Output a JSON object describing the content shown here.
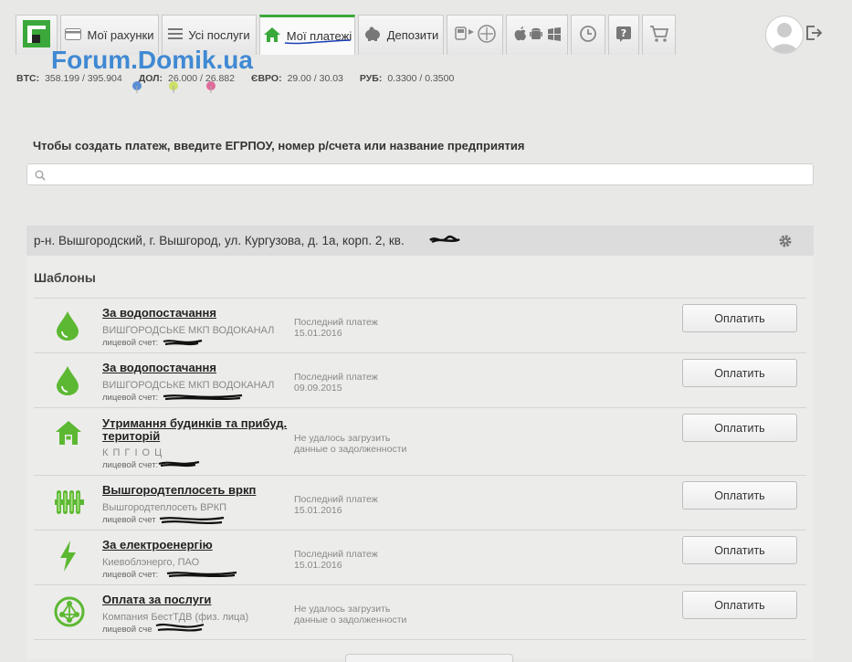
{
  "nav": {
    "tabs": [
      {
        "label": "",
        "icon": "privatbank-logo"
      },
      {
        "label": "Мої рахунки",
        "icon": "card-icon"
      },
      {
        "label": "Усі послуги",
        "icon": "list-icon"
      },
      {
        "label": "Мої платежі",
        "icon": "home-icon"
      },
      {
        "label": "Депозити",
        "icon": "piggybank-icon"
      },
      {
        "label": "",
        "icon": "transport-icon"
      },
      {
        "label": "",
        "icon": "platforms-icon"
      },
      {
        "label": "",
        "icon": "history-icon"
      },
      {
        "label": "",
        "icon": "help-icon"
      },
      {
        "label": "",
        "icon": "cart-icon"
      }
    ],
    "active_tab": "Мої платежі"
  },
  "rates": [
    {
      "name": "BTC:",
      "value": "358.199 / 395.904"
    },
    {
      "name": "ДОЛ:",
      "value": "26.000 / 26.882"
    },
    {
      "name": "ЄВРО:",
      "value": "29.00 / 30.03"
    },
    {
      "name": "РУБ:",
      "value": "0.3300 / 0.3500"
    }
  ],
  "watermark": "Forum.Domik.ua",
  "search": {
    "label": "Чтобы создать платеж, введите ЕГРПОУ, номер р/счета или название предприятия",
    "value": "",
    "placeholder": ""
  },
  "address": "р-н. Вышгородский, г. Вышгород, ул. Кургузова, д. 1а, корп. 2, кв.",
  "templates": {
    "title": "Шаблоны",
    "items": [
      {
        "title": "За водопостачання",
        "company": "ВИШГОРОДСЬКЕ МКП ВОДОКАНАЛ",
        "account": "лицевой счет:",
        "status1": "Последний платеж",
        "status2": "15.01.2016",
        "button": "Оплатить",
        "icon": "water-drop-icon"
      },
      {
        "title": "За водопостачання",
        "company": "ВИШГОРОДСЬКЕ МКП ВОДОКАНАЛ",
        "account": "лицевой счет:",
        "status1": "Последний платеж",
        "status2": "09.09.2015",
        "button": "Оплатить",
        "icon": "water-drop-icon"
      },
      {
        "title": "Утримання будинків та прибуд. територій",
        "company": "К П Г І О Ц",
        "account": "лицевой счет:",
        "status1": "Не удалось загрузить",
        "status2": "данные о задолженности",
        "button": "Оплатить",
        "icon": "house-icon"
      },
      {
        "title": "Вышгородтеплосеть вркп",
        "company": "Вышгородтеплосеть ВРКП",
        "account": "лицевой счет",
        "status1": "Последний платеж",
        "status2": "15.01.2016",
        "button": "Оплатить",
        "icon": "radiator-icon"
      },
      {
        "title": "За електроенергію",
        "company": "Киевоблэнерго, ПАО",
        "account": "лицевой счет:",
        "status1": "Последний платеж",
        "status2": "15.01.2016",
        "button": "Оплатить",
        "icon": "lightning-icon"
      },
      {
        "title": "Оплата за послуги",
        "company": "Компания БестТДВ (физ. лица)",
        "account": "лицевой сче",
        "status1": "Не удалось загрузить",
        "status2": "данные о задолженности",
        "button": "Оплатить",
        "icon": "network-icon"
      }
    ]
  },
  "colors": {
    "brand_green": "#3aa83a",
    "icon_green": "#5cb832",
    "background": "#e8e8e6"
  }
}
